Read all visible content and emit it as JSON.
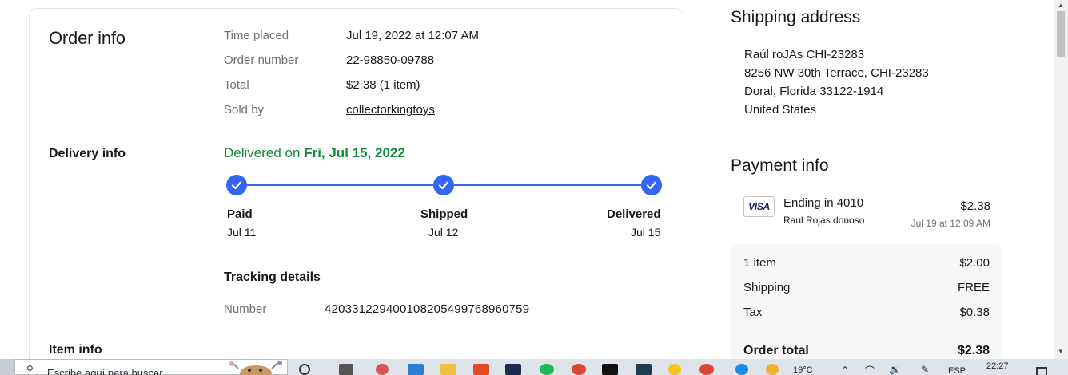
{
  "order_info": {
    "title": "Order info",
    "fields": [
      {
        "label": "Time placed",
        "value": "Jul 19, 2022 at 12:07 AM"
      },
      {
        "label": "Order number",
        "value": "22-98850-09788"
      },
      {
        "label": "Total",
        "value": "$2.38 (1 item)"
      },
      {
        "label": "Sold by",
        "value": "collectorkingtoys"
      }
    ]
  },
  "delivery_info": {
    "title": "Delivery info",
    "status_prefix": "Delivered on",
    "status_date": "Fri, Jul 15, 2022",
    "steps": [
      {
        "label": "Paid",
        "date": "Jul 11"
      },
      {
        "label": "Shipped",
        "date": "Jul 12"
      },
      {
        "label": "Delivered",
        "date": "Jul 15"
      }
    ],
    "tracking_title": "Tracking details",
    "tracking_label": "Number",
    "tracking_number": "420331229400108205499768960759"
  },
  "item_info": {
    "title": "Item info"
  },
  "shipping_address": {
    "title": "Shipping address",
    "lines": [
      "Raúl roJAs CHI-23283",
      "8256 NW 30th Terrace, CHI-23283",
      "Doral, Florida 33122-1914",
      "United States"
    ]
  },
  "payment_info": {
    "title": "Payment info",
    "card_brand": "VISA",
    "ending": "Ending in 4010",
    "holder": "Raul Rojas donoso",
    "amount": "$2.38",
    "date": "Jul 19 at 12:09 AM"
  },
  "summary": {
    "rows": [
      {
        "label": "1 item",
        "value": "$2.00"
      },
      {
        "label": "Shipping",
        "value": "FREE"
      },
      {
        "label": "Tax",
        "value": "$0.38"
      }
    ],
    "total_label": "Order total",
    "total_value": "$2.38"
  },
  "taskbar": {
    "search_placeholder": "Escribe aquí para buscar",
    "temperature": "19°C",
    "language": "ESP",
    "time": "22:27"
  },
  "colors": {
    "accent_blue": "#3665f3",
    "delivered_green": "#118a3b",
    "muted_text": "#707070"
  }
}
